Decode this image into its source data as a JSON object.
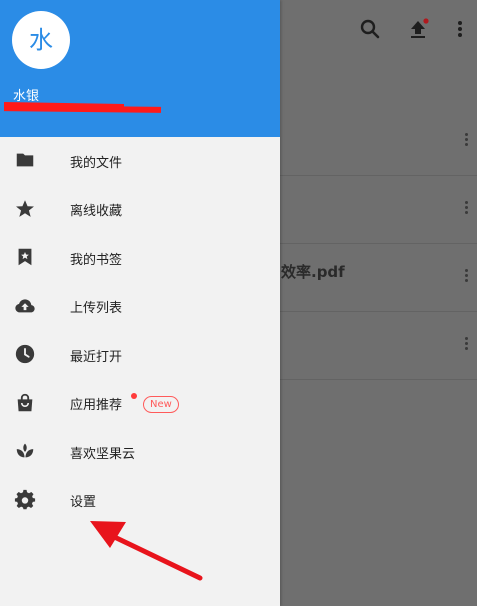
{
  "background": {
    "rows": [
      {
        "text": ""
      },
      {
        "text": ""
      },
      {
        "text": "效率.pdf"
      },
      {
        "text": ""
      }
    ]
  },
  "drawer": {
    "avatar_text": "水",
    "username": "水银",
    "menu": [
      {
        "label": "我的文件",
        "icon": "folder-icon"
      },
      {
        "label": "离线收藏",
        "icon": "star-icon"
      },
      {
        "label": "我的书签",
        "icon": "bookmark-icon"
      },
      {
        "label": "上传列表",
        "icon": "cloud-upload-icon"
      },
      {
        "label": "最近打开",
        "icon": "clock-icon"
      },
      {
        "label": "应用推荐",
        "icon": "shopping-bag-icon",
        "badge": "New"
      },
      {
        "label": "喜欢坚果云",
        "icon": "leaf-icon"
      },
      {
        "label": "设置",
        "icon": "gear-icon"
      }
    ]
  },
  "colors": {
    "header_blue": "#2b8ce6",
    "badge_red": "#ff5a5a",
    "annotation_red": "#e8141c"
  }
}
